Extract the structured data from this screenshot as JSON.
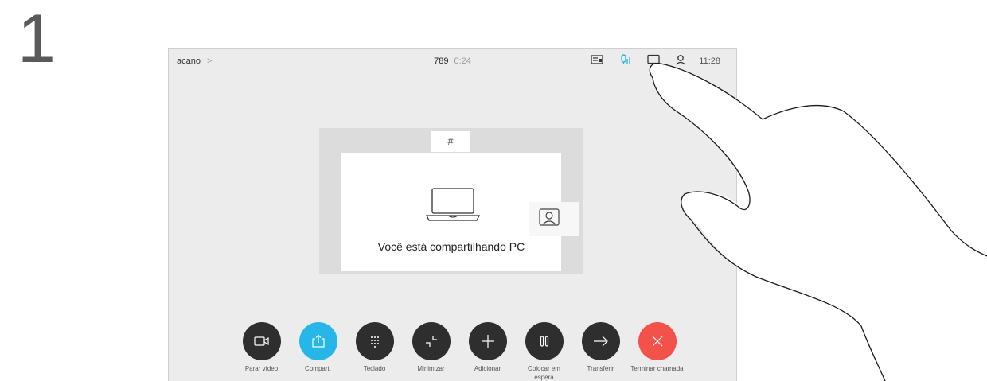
{
  "step": {
    "number": "1"
  },
  "topbar": {
    "breadcrumb": "acano",
    "chevron": ">",
    "call_number": "789",
    "call_duration": "0:24",
    "time": "11:28",
    "icons": [
      "layout-icon",
      "microphone-icon",
      "chat-icon",
      "person-icon"
    ]
  },
  "share": {
    "tab_label": "#",
    "message": "Você está compartilhando PC"
  },
  "controls": [
    {
      "id": "video",
      "label": "Parar vídeo",
      "icon": "camera-icon"
    },
    {
      "id": "share",
      "label": "Compart.",
      "icon": "share-icon",
      "active": true
    },
    {
      "id": "keypad",
      "label": "Teclado",
      "icon": "keypad-icon"
    },
    {
      "id": "minimize",
      "label": "Minimizar",
      "icon": "minimize-icon"
    },
    {
      "id": "add",
      "label": "Adicionar",
      "icon": "plus-icon"
    },
    {
      "id": "hold",
      "label": "Colocar em espera",
      "icon": "pause-icon"
    },
    {
      "id": "transfer",
      "label": "Transferir",
      "icon": "arrow-right-icon"
    },
    {
      "id": "end",
      "label": "Terminar chamada",
      "icon": "close-icon"
    }
  ],
  "colors": {
    "share_active": "#26b6e8",
    "end_call": "#f2524a",
    "button_dark": "#2e2e2e",
    "mic_active": "#26b6e8"
  }
}
